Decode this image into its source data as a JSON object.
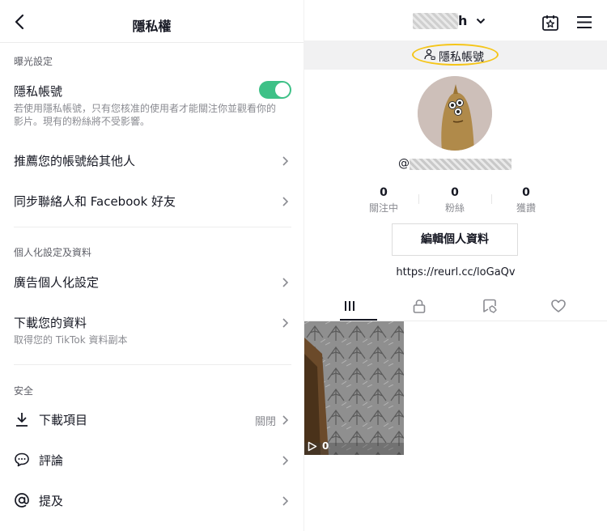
{
  "settings": {
    "title": "隱私權",
    "sections": {
      "exposure": "曝光設定",
      "personalization": "個人化設定及資料",
      "safety": "安全"
    },
    "private_account": {
      "label": "隱私帳號",
      "description_line1": "若使用隱私帳號，只有您核准的使用者才能關注你並觀看你的",
      "description_line2": "影片。現有的粉絲將不受影響。",
      "enabled": true
    },
    "suggest_account": "推薦您的帳號給其他人",
    "sync_contacts": "同步聯絡人和 Facebook 好友",
    "ad_personalization": "廣告個人化設定",
    "download_data": {
      "label": "下載您的資料",
      "sub": "取得您的 TikTok 資料副本"
    },
    "downloads": {
      "label": "下載項目",
      "value": "關閉"
    },
    "comments": "評論",
    "mentions": "提及"
  },
  "profile": {
    "username_visible_tail": "h",
    "private_badge": "隱私帳號",
    "handle_prefix": "@",
    "stats": [
      {
        "value": "0",
        "label": "關注中"
      },
      {
        "value": "0",
        "label": "粉絲"
      },
      {
        "value": "0",
        "label": "獲讚"
      }
    ],
    "edit_profile": "編輯個人資料",
    "bio_link": "https://reurl.cc/loGaQv",
    "videos": [
      {
        "play_count": "0"
      }
    ],
    "accent_yellow": "#f5c518",
    "toggle_green": "#3ec187"
  }
}
